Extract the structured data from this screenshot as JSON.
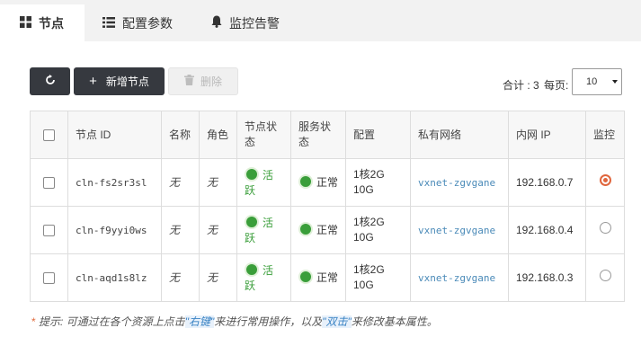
{
  "tabs": [
    {
      "label": "节点",
      "icon": "grid-icon",
      "active": true
    },
    {
      "label": "配置参数",
      "icon": "list-icon",
      "active": false
    },
    {
      "label": "监控告警",
      "icon": "bell-icon",
      "active": false
    }
  ],
  "toolbar": {
    "add_label": "新增节点",
    "delete_label": "删除"
  },
  "pager": {
    "total_text": "合计 : 3",
    "per_page_label": "每页:",
    "page_size": "10"
  },
  "table": {
    "headers": {
      "node_id": "节点 ID",
      "name": "名称",
      "role": "角色",
      "node_status": "节点状态",
      "service_status": "服务状态",
      "config": "配置",
      "private_network": "私有网络",
      "private_ip": "内网 IP",
      "monitor": "监控"
    },
    "rows": [
      {
        "id": "cln-fs2sr3sl",
        "name": "无",
        "role": "无",
        "node_status": "活跃",
        "service_status": "正常",
        "config": "1核2G 10G",
        "network": "vxnet-zgvgane",
        "ip": "192.168.0.7",
        "monitor_selected": true
      },
      {
        "id": "cln-f9yyi0ws",
        "name": "无",
        "role": "无",
        "node_status": "活跃",
        "service_status": "正常",
        "config": "1核2G 10G",
        "network": "vxnet-zgvgane",
        "ip": "192.168.0.4",
        "monitor_selected": false
      },
      {
        "id": "cln-aqd1s8lz",
        "name": "无",
        "role": "无",
        "node_status": "活跃",
        "service_status": "正常",
        "config": "1核2G 10G",
        "network": "vxnet-zgvgane",
        "ip": "192.168.0.3",
        "monitor_selected": false
      }
    ]
  },
  "tip": {
    "star": "*",
    "prefix": "提示: 可通过在各个资源上点击",
    "kw1": "\"右键\"",
    "middle": "来进行常用操作，以及",
    "kw2": "\"双击\"",
    "suffix": "来修改基本属性。"
  },
  "colors": {
    "status_green": "#3a9e3a",
    "radio_selected": "#e0663d",
    "link_blue": "#4a8ab8"
  }
}
